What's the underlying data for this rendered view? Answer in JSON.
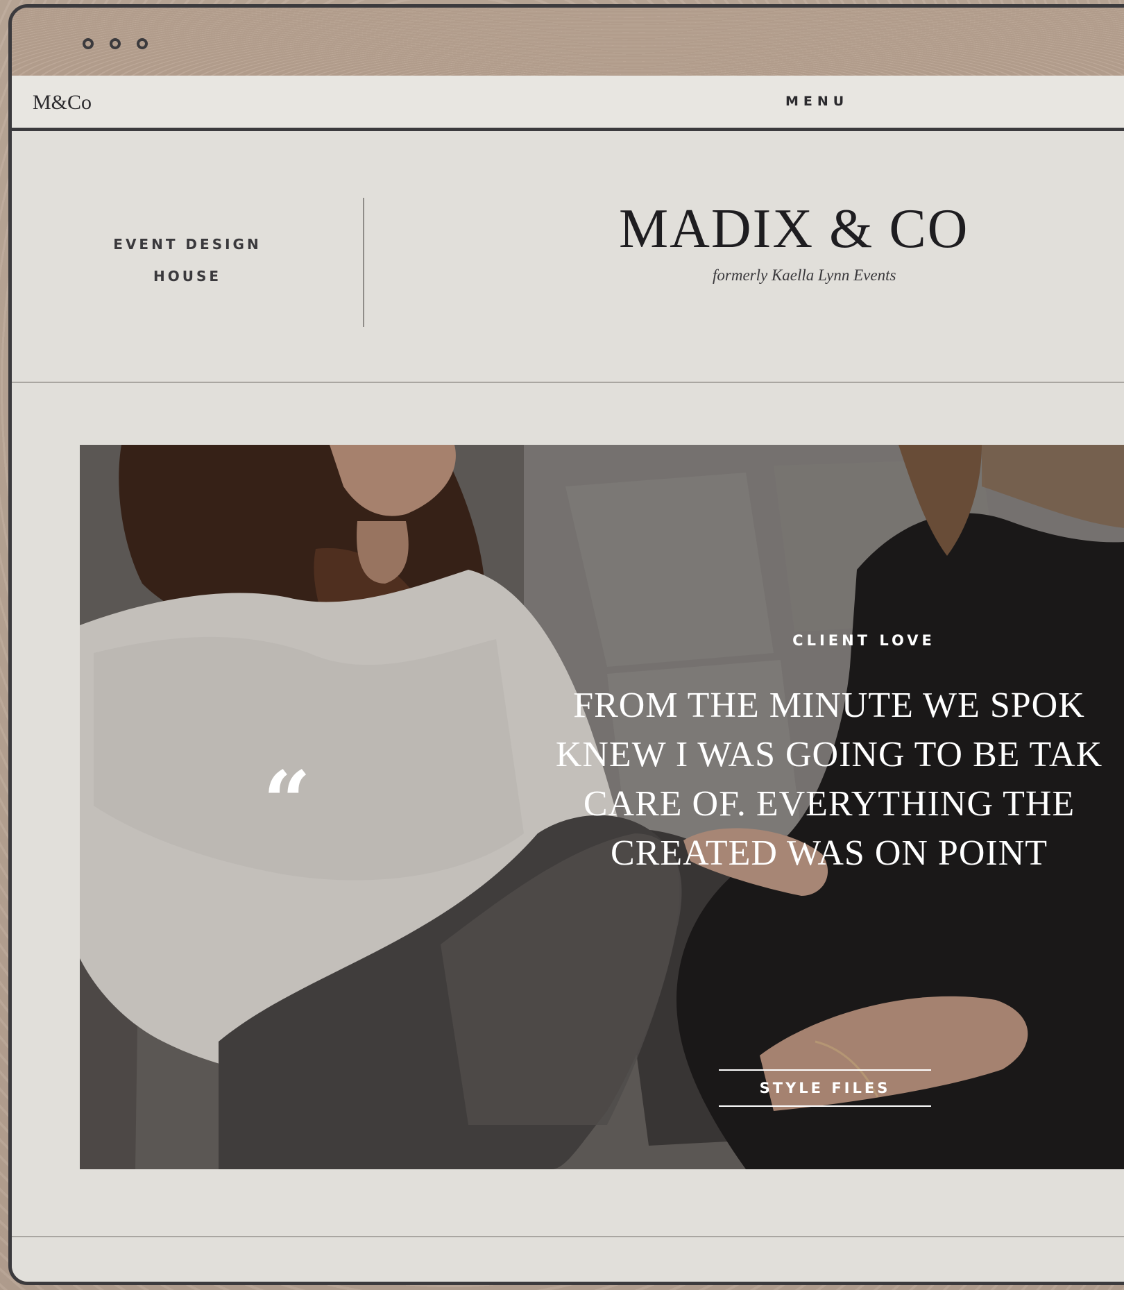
{
  "window": {
    "controls": [
      "close",
      "minimize",
      "maximize"
    ]
  },
  "nav": {
    "logo": "M&Co",
    "menu_label": "MENU"
  },
  "brand": {
    "tagline_line1": "EVENT DESIGN",
    "tagline_line2": "HOUSE",
    "name": "MADIX & CO",
    "subtitle": "formerly Kaella Lynn Events"
  },
  "hero": {
    "eyebrow": "CLIENT LOVE",
    "quote_mark": "“",
    "quote_lines": [
      "FROM THE MINUTE WE SPOK",
      "KNEW I WAS GOING TO BE TAK",
      "CARE OF. EVERYTHING THE",
      "CREATED WAS ON POINT"
    ],
    "cta_label": "STYLE FILES"
  },
  "colors": {
    "frame": "#3b3a3d",
    "page_background": "#e1dfda",
    "desk_background": "#b9a595",
    "hero_text": "#ffffff"
  }
}
